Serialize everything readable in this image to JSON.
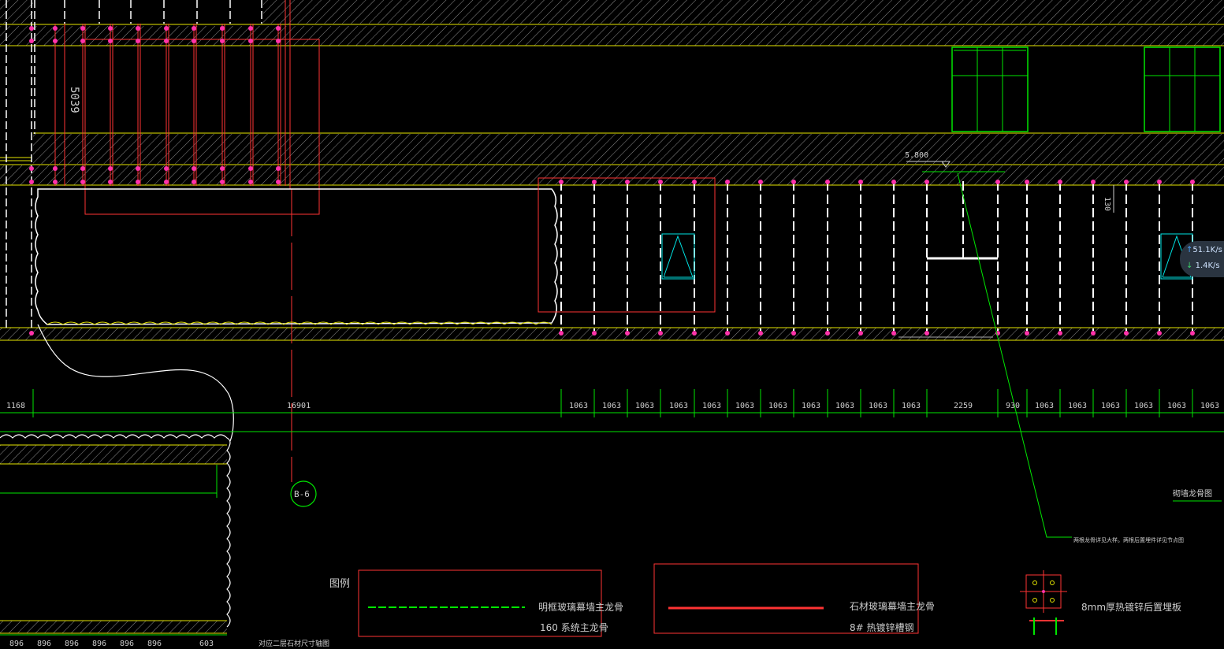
{
  "colors": {
    "background": "#000000",
    "yellow": "#e6e600",
    "red": "#ff3333",
    "green": "#00e600",
    "white": "#ffffff",
    "cyan": "#00e5e5",
    "magenta": "#ff33aa",
    "hatch": "#9a9a9a"
  },
  "drawing": {
    "vertical_dim": "5039",
    "top_offset": "130",
    "elevation": "5.800",
    "dim_left": "1168",
    "dim_total": "16901",
    "dim_panel": "1063",
    "dim_center": "2259",
    "dim_930": "930",
    "dims_right": [
      "1063",
      "1063",
      "1063",
      "1063",
      "1063",
      "1063"
    ],
    "dims_bottom": [
      "896",
      "896",
      "896",
      "896",
      "896",
      "896",
      "603"
    ],
    "axis_label": "B-6",
    "bottom_caption": "对应二层石材尺寸轴图",
    "right_caption": "砌墙龙骨图",
    "leader_note": "两根龙骨详见大样。两根后置埋件详见节点图"
  },
  "legend": {
    "title": "图例",
    "item1_line1": "明框玻璃幕墙主龙骨",
    "item1_line2": "160  系统主龙骨",
    "item2_line1": "石材玻璃幕墙主龙骨",
    "item2_line2": "8# 热镀锌槽钢",
    "item3": "8mm厚热镀锌后置埋板"
  },
  "net_widget": {
    "up_arrow": "↑",
    "up": "51.1",
    "up_unit": "K/s",
    "down_arrow": "↓",
    "down": "1.4",
    "down_unit": "K/s"
  }
}
